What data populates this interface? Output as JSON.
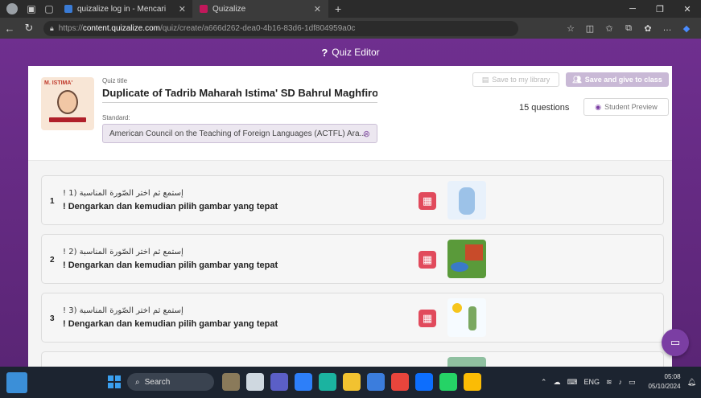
{
  "browser": {
    "tabs": [
      {
        "title": "quizalize log in - Mencari",
        "active": false
      },
      {
        "title": "Quizalize",
        "active": true
      }
    ],
    "url_prefix": "https://",
    "url_host": "content.quizalize.com",
    "url_path": "/quiz/create/a666d262-dea0-4b16-83d6-1df804959a0c"
  },
  "editor": {
    "header_title": "Quiz Editor",
    "quiz_title_label": "Quiz title",
    "quiz_title": "Duplicate of Tadrib Maharah Istima' SD Bahrul Maghfiroh Malang",
    "standard_label": "Standard:",
    "standard_value": "American Council on the Teaching of Foreign Languages (ACTFL) Ara...",
    "thumb_label": "M. ISTIMA'",
    "save_library_label": "Save to my library",
    "save_give_label": "Save and give to class",
    "question_count": "15 questions",
    "student_preview_label": "Student Preview"
  },
  "questions": [
    {
      "number": "1",
      "arabic": "! إستمع ثم اختر الصّورة المناسبة (1",
      "indonesian": "! Dengarkan dan kemudian pilih gambar yang tepat"
    },
    {
      "number": "2",
      "arabic": "! إستمع ثم اختر الصّورة المناسبة (2",
      "indonesian": "! Dengarkan dan kemudian pilih gambar yang tepat"
    },
    {
      "number": "3",
      "arabic": "! إستمع ثم اختر الصّورة المناسبة (3",
      "indonesian": "! Dengarkan dan kemudian pilih gambar yang tepat"
    }
  ],
  "taskbar": {
    "search_placeholder": "Search",
    "language": "ENG",
    "time": "05:08",
    "date": "05/10/2024"
  },
  "colors": {
    "brand_purple": "#6f2f8f",
    "accent_red": "#e14a5c",
    "disabled_purple": "#c9b9d6"
  }
}
